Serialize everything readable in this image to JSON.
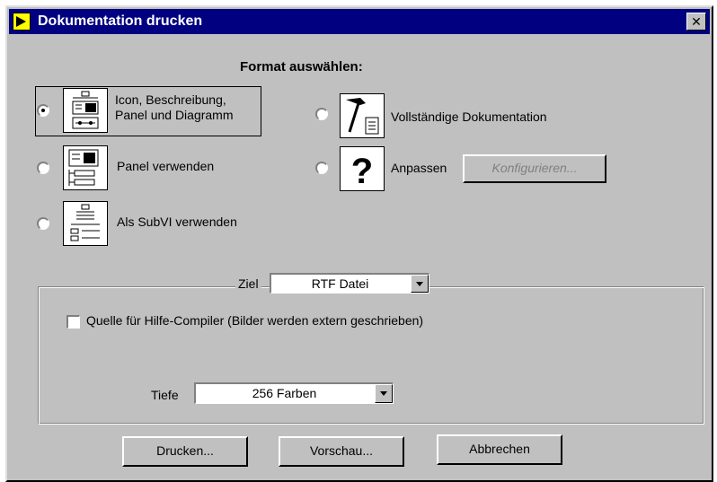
{
  "window": {
    "title": "Dokumentation drucken",
    "close_glyph": "✕"
  },
  "format": {
    "heading": "Format auswählen:",
    "options": [
      {
        "label_line1": "Icon, Beschreibung,",
        "label_line2": "Panel und Diagramm",
        "icon": "icon-description-panel-diagram-icon",
        "selected": true
      },
      {
        "label": "Panel verwenden",
        "icon": "panel-icon",
        "selected": false
      },
      {
        "label": "Als SubVI verwenden",
        "icon": "subvi-icon",
        "selected": false
      },
      {
        "label": "Vollständige Dokumentation",
        "icon": "hammer-document-icon",
        "selected": false
      },
      {
        "label": "Anpassen",
        "icon": "question-mark-icon",
        "selected": false
      }
    ],
    "configure_button": "Konfigurieren..."
  },
  "destination": {
    "label": "Ziel",
    "value": "RTF Datei",
    "checkbox_label": "Quelle für Hilfe-Compiler (Bilder werden extern geschrieben)",
    "checkbox_checked": false,
    "depth_label": "Tiefe",
    "depth_value": "256 Farben"
  },
  "buttons": {
    "print": "Drucken...",
    "preview": "Vorschau...",
    "cancel": "Abbrechen"
  },
  "colors": {
    "titlebar": "#000080",
    "face": "#c0c0c0"
  }
}
